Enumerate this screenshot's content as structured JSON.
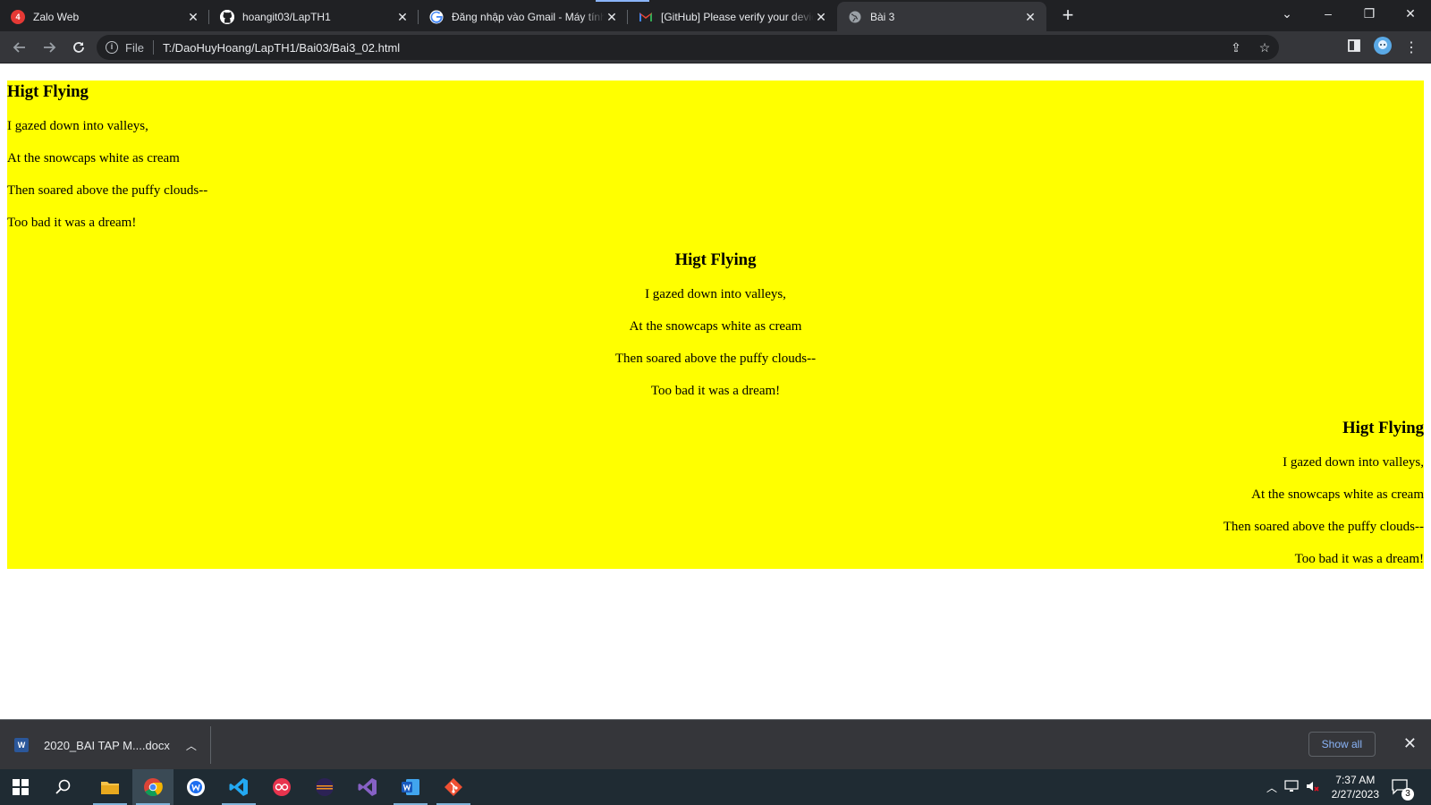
{
  "tabs": [
    {
      "title": "Zalo Web",
      "favicon": "zalo-icon",
      "badge": "4"
    },
    {
      "title": "hoangit03/LapTH1",
      "favicon": "github-icon"
    },
    {
      "title": "Đăng nhập vào Gmail - Máy tính",
      "favicon": "google-icon"
    },
    {
      "title": "[GitHub] Please verify your device",
      "favicon": "gmail-icon"
    },
    {
      "title": "Bài 3",
      "favicon": "globe-icon",
      "active": true
    }
  ],
  "toolbar": {
    "scheme_label": "File",
    "url": "T:/DaoHuyHoang/LapTH1/Bai03/Bai3_02.html"
  },
  "poems": [
    {
      "align": "left",
      "title": "Higt Flying",
      "lines": [
        "I gazed down into valleys,",
        "At the snowcaps white as cream",
        "Then soared above the puffy clouds--",
        "Too bad it was a dream!"
      ]
    },
    {
      "align": "center",
      "title": "Higt Flying",
      "lines": [
        "I gazed down into valleys,",
        "At the snowcaps white as cream",
        "Then soared above the puffy clouds--",
        "Too bad it was a dream!"
      ]
    },
    {
      "align": "right",
      "title": "Higt Flying",
      "lines": [
        "I gazed down into valleys,",
        "At the snowcaps white as cream",
        "Then soared above the puffy clouds--",
        "Too bad it was a dream!"
      ]
    }
  ],
  "colors": {
    "page_background": "#ffff00",
    "tab_strip": "#202124",
    "toolbar": "#35363a"
  },
  "downloads": {
    "file_name": "2020_BAI TAP M....docx",
    "show_all_label": "Show all"
  },
  "taskbar": {
    "apps": [
      "windows-start-icon",
      "search-icon",
      "file-explorer-icon",
      "chrome-icon",
      "windows-app-icon",
      "vscode-icon",
      "app-icon",
      "eclipse-icon",
      "visual-studio-icon",
      "word-icon",
      "git-icon"
    ],
    "time": "7:37 AM",
    "date": "2/27/2023",
    "notification_count": "3"
  }
}
